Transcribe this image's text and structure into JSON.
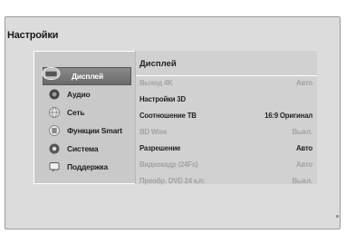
{
  "header": {
    "title": "Настройки"
  },
  "sidebar": {
    "items": [
      {
        "label": "Дисплей",
        "icon": "display-icon",
        "selected": true
      },
      {
        "label": "Аудио",
        "icon": "speaker-icon"
      },
      {
        "label": "Сеть",
        "icon": "network-icon"
      },
      {
        "label": "Функции Smart",
        "icon": "smart-icon"
      },
      {
        "label": "Система",
        "icon": "system-icon"
      },
      {
        "label": "Поддержка",
        "icon": "support-icon"
      }
    ]
  },
  "content": {
    "title": "Дисплей",
    "rows": [
      {
        "label": "Выход 4K",
        "value": "Авто",
        "enabled": false
      },
      {
        "label": "Настройки 3D",
        "value": "",
        "enabled": true
      },
      {
        "label": "Соотношение ТВ",
        "value": "16:9 Оригинал",
        "enabled": true
      },
      {
        "label": "BD Wise",
        "value": "Выкл.",
        "enabled": false
      },
      {
        "label": "Разрешение",
        "value": "Авто",
        "enabled": true
      },
      {
        "label": "Видеокадр (24Fs)",
        "value": "Авто",
        "enabled": false
      },
      {
        "label": "Преобр. DVD 24 к./с",
        "value": "Выкл.",
        "enabled": false
      }
    ]
  },
  "colors": {
    "enabled_text": "#1f1f1f",
    "disabled_text": "#a2a2a2",
    "selected_bg": "#777777"
  }
}
